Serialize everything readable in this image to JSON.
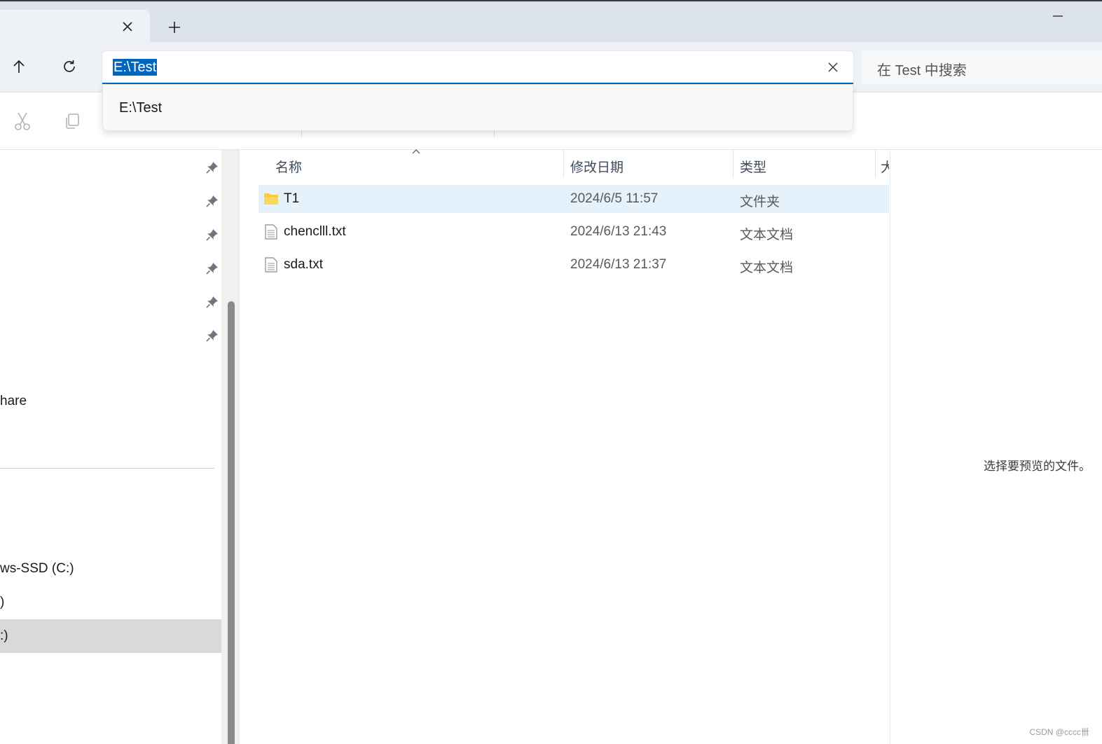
{
  "window": {
    "new_tab_symbol": "+"
  },
  "address_bar": {
    "path": "E:\\Test"
  },
  "search": {
    "placeholder": "在 Test 中搜索"
  },
  "dropdown": {
    "suggestion": "E:\\Test"
  },
  "sidebar": {
    "items": [
      {
        "label": "hare"
      },
      {
        "label": "ws-SSD (C:)"
      },
      {
        "label": ")"
      },
      {
        "label": ":)"
      }
    ]
  },
  "file_list": {
    "columns": {
      "name": "名称",
      "date": "修改日期",
      "type": "类型",
      "size": "大"
    },
    "rows": [
      {
        "name": "T1",
        "date": "2024/6/5 11:57",
        "type": "文件夹",
        "icon": "folder-icon"
      },
      {
        "name": "chenclll.txt",
        "date": "2024/6/13 21:43",
        "type": "文本文档",
        "icon": "text-file-icon"
      },
      {
        "name": "sda.txt",
        "date": "2024/6/13 21:37",
        "type": "文本文档",
        "icon": "text-file-icon"
      }
    ]
  },
  "preview": {
    "message": "选择要预览的文件。"
  },
  "watermark": {
    "text": "CSDN @cccc卌"
  },
  "colors": {
    "accent": "#0067c0",
    "selected_row": "#e5f1fb",
    "titlebar": "#dde3ea",
    "folder": "#f8c93b"
  }
}
